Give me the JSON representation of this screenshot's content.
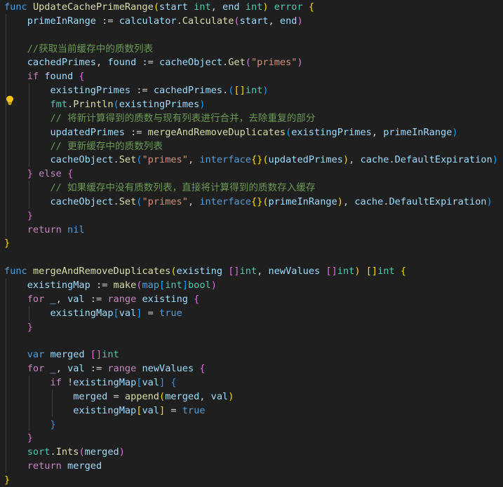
{
  "colors": {
    "kw": "#569cd6",
    "ctl": "#c586c0",
    "fn": "#dcdcaa",
    "var": "#9cdcfe",
    "type": "#4ec9b0",
    "str": "#ce9178",
    "cm": "#6a9955",
    "p": "#cccccc",
    "b1": "#ffd700",
    "b2": "#da70d6",
    "b3": "#179fff",
    "bool": "#569cd6"
  },
  "lines": [
    {
      "indent": 0,
      "tokens": [
        [
          "func",
          "kw"
        ],
        [
          " ",
          "p"
        ],
        [
          "UpdateCachePrimeRange",
          "fn"
        ],
        [
          "(",
          "b1"
        ],
        [
          "start",
          "var"
        ],
        [
          " ",
          "p"
        ],
        [
          "int",
          "type"
        ],
        [
          ", ",
          "p"
        ],
        [
          "end",
          "var"
        ],
        [
          " ",
          "p"
        ],
        [
          "int",
          "type"
        ],
        [
          ")",
          "b1"
        ],
        [
          " ",
          "p"
        ],
        [
          "error",
          "type"
        ],
        [
          " ",
          "p"
        ],
        [
          "{",
          "b1"
        ]
      ]
    },
    {
      "indent": 1,
      "tokens": [
        [
          "primeInRange",
          "var"
        ],
        [
          " := ",
          "p"
        ],
        [
          "calculator",
          "var"
        ],
        [
          ".",
          "p"
        ],
        [
          "Calculate",
          "fn"
        ],
        [
          "(",
          "b2"
        ],
        [
          "start",
          "var"
        ],
        [
          ", ",
          "p"
        ],
        [
          "end",
          "var"
        ],
        [
          ")",
          "b2"
        ]
      ]
    },
    {
      "indent": 0,
      "tokens": []
    },
    {
      "indent": 1,
      "tokens": [
        [
          "//获取当前缓存中的质数列表",
          "cm"
        ]
      ]
    },
    {
      "indent": 1,
      "tokens": [
        [
          "cachedPrimes",
          "var"
        ],
        [
          ", ",
          "p"
        ],
        [
          "found",
          "var"
        ],
        [
          " := ",
          "p"
        ],
        [
          "cacheObject",
          "var"
        ],
        [
          ".",
          "p"
        ],
        [
          "Get",
          "fn"
        ],
        [
          "(",
          "b2"
        ],
        [
          "\"primes\"",
          "str"
        ],
        [
          ")",
          "b2"
        ]
      ]
    },
    {
      "indent": 1,
      "tokens": [
        [
          "if",
          "ctl"
        ],
        [
          " ",
          "p"
        ],
        [
          "found",
          "var"
        ],
        [
          " ",
          "p"
        ],
        [
          "{",
          "b2"
        ]
      ]
    },
    {
      "indent": 2,
      "tokens": [
        [
          "existingPrimes",
          "var"
        ],
        [
          " := ",
          "p"
        ],
        [
          "cachedPrimes",
          "var"
        ],
        [
          ".",
          "p"
        ],
        [
          "(",
          "b3"
        ],
        [
          "[]",
          "b1"
        ],
        [
          "int",
          "type"
        ],
        [
          ")",
          "b3"
        ]
      ]
    },
    {
      "indent": 2,
      "tokens": [
        [
          "fmt",
          "type"
        ],
        [
          ".",
          "p"
        ],
        [
          "Println",
          "fn"
        ],
        [
          "(",
          "b3"
        ],
        [
          "existingPrimes",
          "var"
        ],
        [
          ")",
          "b3"
        ]
      ]
    },
    {
      "indent": 2,
      "tokens": [
        [
          "// 将新计算得到的质数与现有列表进行合并，去除重复的部分",
          "cm"
        ]
      ]
    },
    {
      "indent": 2,
      "tokens": [
        [
          "updatedPrimes",
          "var"
        ],
        [
          " := ",
          "p"
        ],
        [
          "mergeAndRemoveDuplicates",
          "fn"
        ],
        [
          "(",
          "b3"
        ],
        [
          "existingPrimes",
          "var"
        ],
        [
          ", ",
          "p"
        ],
        [
          "primeInRange",
          "var"
        ],
        [
          ")",
          "b3"
        ]
      ]
    },
    {
      "indent": 2,
      "tokens": [
        [
          "// 更新缓存中的质数列表",
          "cm"
        ]
      ]
    },
    {
      "indent": 2,
      "tokens": [
        [
          "cacheObject",
          "var"
        ],
        [
          ".",
          "p"
        ],
        [
          "Set",
          "fn"
        ],
        [
          "(",
          "b3"
        ],
        [
          "\"primes\"",
          "str"
        ],
        [
          ", ",
          "p"
        ],
        [
          "interface",
          "kw"
        ],
        [
          "{}",
          "b1"
        ],
        [
          "(",
          "b1"
        ],
        [
          "updatedPrimes",
          "var"
        ],
        [
          ")",
          "b1"
        ],
        [
          ", ",
          "p"
        ],
        [
          "cache",
          "var"
        ],
        [
          ".",
          "p"
        ],
        [
          "DefaultExpiration",
          "var"
        ],
        [
          ")",
          "b3"
        ]
      ]
    },
    {
      "indent": 1,
      "tokens": [
        [
          "}",
          "b2"
        ],
        [
          " ",
          "p"
        ],
        [
          "else",
          "ctl"
        ],
        [
          " ",
          "p"
        ],
        [
          "{",
          "b2"
        ]
      ]
    },
    {
      "indent": 2,
      "tokens": [
        [
          "// 如果缓存中没有质数列表，直接将计算得到的质数存入缓存",
          "cm"
        ]
      ]
    },
    {
      "indent": 2,
      "tokens": [
        [
          "cacheObject",
          "var"
        ],
        [
          ".",
          "p"
        ],
        [
          "Set",
          "fn"
        ],
        [
          "(",
          "b3"
        ],
        [
          "\"primes\"",
          "str"
        ],
        [
          ", ",
          "p"
        ],
        [
          "interface",
          "kw"
        ],
        [
          "{}",
          "b1"
        ],
        [
          "(",
          "b1"
        ],
        [
          "primeInRange",
          "var"
        ],
        [
          ")",
          "b1"
        ],
        [
          ", ",
          "p"
        ],
        [
          "cache",
          "var"
        ],
        [
          ".",
          "p"
        ],
        [
          "DefaultExpiration",
          "var"
        ],
        [
          ")",
          "b3"
        ]
      ]
    },
    {
      "indent": 1,
      "tokens": [
        [
          "}",
          "b2"
        ]
      ]
    },
    {
      "indent": 1,
      "tokens": [
        [
          "return",
          "ctl"
        ],
        [
          " ",
          "p"
        ],
        [
          "nil",
          "kw"
        ]
      ]
    },
    {
      "indent": 0,
      "tokens": [
        [
          "}",
          "b1"
        ]
      ]
    },
    {
      "indent": 0,
      "tokens": []
    },
    {
      "indent": 0,
      "tokens": [
        [
          "func",
          "kw"
        ],
        [
          " ",
          "p"
        ],
        [
          "mergeAndRemoveDuplicates",
          "fn"
        ],
        [
          "(",
          "b1"
        ],
        [
          "existing",
          "var"
        ],
        [
          " ",
          "p"
        ],
        [
          "[]",
          "b2"
        ],
        [
          "int",
          "type"
        ],
        [
          ", ",
          "p"
        ],
        [
          "newValues",
          "var"
        ],
        [
          " ",
          "p"
        ],
        [
          "[]",
          "b2"
        ],
        [
          "int",
          "type"
        ],
        [
          ")",
          "b1"
        ],
        [
          " ",
          "p"
        ],
        [
          "[]",
          "b1"
        ],
        [
          "int",
          "type"
        ],
        [
          " ",
          "p"
        ],
        [
          "{",
          "b1"
        ]
      ]
    },
    {
      "indent": 1,
      "tokens": [
        [
          "existingMap",
          "var"
        ],
        [
          " := ",
          "p"
        ],
        [
          "make",
          "fn"
        ],
        [
          "(",
          "b2"
        ],
        [
          "map",
          "kw"
        ],
        [
          "[",
          "b3"
        ],
        [
          "int",
          "type"
        ],
        [
          "]",
          "b3"
        ],
        [
          "bool",
          "type"
        ],
        [
          ")",
          "b2"
        ]
      ]
    },
    {
      "indent": 1,
      "tokens": [
        [
          "for",
          "ctl"
        ],
        [
          " ",
          "p"
        ],
        [
          "_",
          "var"
        ],
        [
          ", ",
          "p"
        ],
        [
          "val",
          "var"
        ],
        [
          " := ",
          "p"
        ],
        [
          "range",
          "ctl"
        ],
        [
          " ",
          "p"
        ],
        [
          "existing",
          "var"
        ],
        [
          " ",
          "p"
        ],
        [
          "{",
          "b2"
        ]
      ]
    },
    {
      "indent": 2,
      "tokens": [
        [
          "existingMap",
          "var"
        ],
        [
          "[",
          "b3"
        ],
        [
          "val",
          "var"
        ],
        [
          "]",
          "b3"
        ],
        [
          " = ",
          "p"
        ],
        [
          "true",
          "bool"
        ]
      ]
    },
    {
      "indent": 1,
      "tokens": [
        [
          "}",
          "b2"
        ]
      ]
    },
    {
      "indent": 0,
      "tokens": []
    },
    {
      "indent": 1,
      "tokens": [
        [
          "var",
          "kw"
        ],
        [
          " ",
          "p"
        ],
        [
          "merged",
          "var"
        ],
        [
          " ",
          "p"
        ],
        [
          "[]",
          "b2"
        ],
        [
          "int",
          "type"
        ]
      ]
    },
    {
      "indent": 1,
      "tokens": [
        [
          "for",
          "ctl"
        ],
        [
          " ",
          "p"
        ],
        [
          "_",
          "var"
        ],
        [
          ", ",
          "p"
        ],
        [
          "val",
          "var"
        ],
        [
          " := ",
          "p"
        ],
        [
          "range",
          "ctl"
        ],
        [
          " ",
          "p"
        ],
        [
          "newValues",
          "var"
        ],
        [
          " ",
          "p"
        ],
        [
          "{",
          "b2"
        ]
      ]
    },
    {
      "indent": 2,
      "tokens": [
        [
          "if",
          "ctl"
        ],
        [
          " !",
          "p"
        ],
        [
          "existingMap",
          "var"
        ],
        [
          "[",
          "b3"
        ],
        [
          "val",
          "var"
        ],
        [
          "]",
          "b3"
        ],
        [
          " ",
          "p"
        ],
        [
          "{",
          "b3"
        ]
      ]
    },
    {
      "indent": 3,
      "tokens": [
        [
          "merged",
          "var"
        ],
        [
          " = ",
          "p"
        ],
        [
          "append",
          "fn"
        ],
        [
          "(",
          "b1"
        ],
        [
          "merged",
          "var"
        ],
        [
          ", ",
          "p"
        ],
        [
          "val",
          "var"
        ],
        [
          ")",
          "b1"
        ]
      ]
    },
    {
      "indent": 3,
      "tokens": [
        [
          "existingMap",
          "var"
        ],
        [
          "[",
          "b1"
        ],
        [
          "val",
          "var"
        ],
        [
          "]",
          "b1"
        ],
        [
          " = ",
          "p"
        ],
        [
          "true",
          "bool"
        ]
      ]
    },
    {
      "indent": 2,
      "tokens": [
        [
          "}",
          "b3"
        ]
      ]
    },
    {
      "indent": 1,
      "tokens": [
        [
          "}",
          "b2"
        ]
      ]
    },
    {
      "indent": 1,
      "tokens": [
        [
          "sort",
          "type"
        ],
        [
          ".",
          "p"
        ],
        [
          "Ints",
          "fn"
        ],
        [
          "(",
          "b2"
        ],
        [
          "merged",
          "var"
        ],
        [
          ")",
          "b2"
        ]
      ]
    },
    {
      "indent": 1,
      "tokens": [
        [
          "return",
          "ctl"
        ],
        [
          " ",
          "p"
        ],
        [
          "merged",
          "var"
        ]
      ]
    },
    {
      "indent": 0,
      "tokens": [
        [
          "}",
          "b1"
        ]
      ]
    }
  ],
  "lightbulb_icon": "lightbulb-icon"
}
